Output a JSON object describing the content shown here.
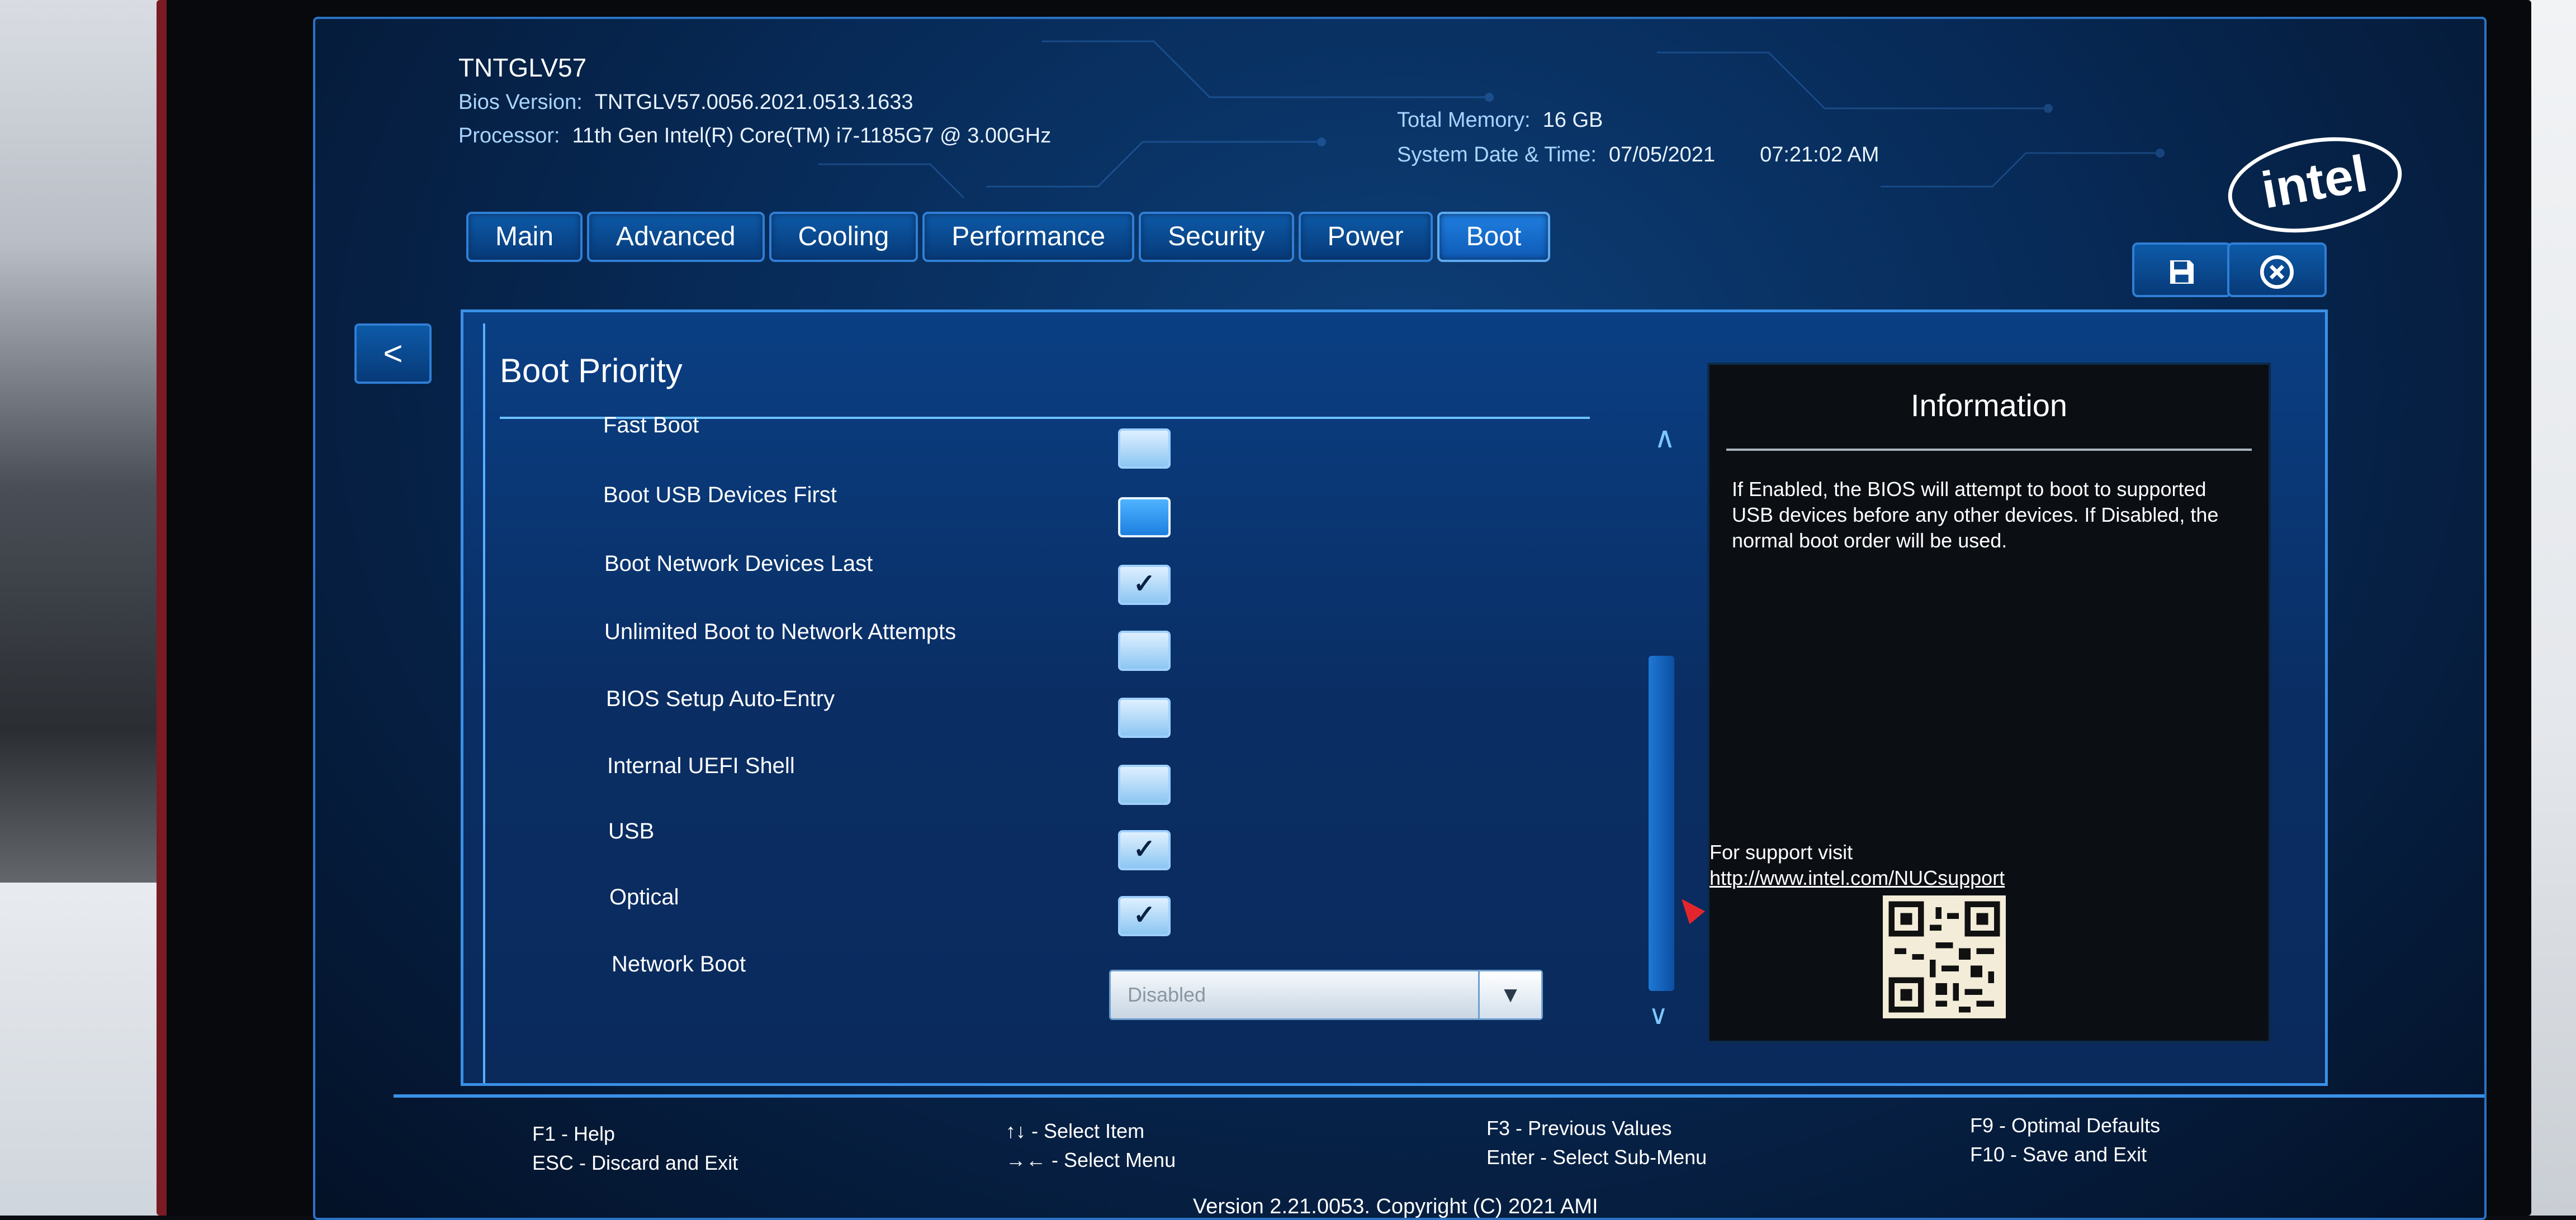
{
  "header": {
    "model": "TNTGLV57",
    "bios_version_label": "Bios Version:",
    "bios_version": "TNTGLV57.0056.2021.0513.1633",
    "processor_label": "Processor:",
    "processor": "11th Gen Intel(R) Core(TM) i7-1185G7 @ 3.00GHz",
    "total_memory_label": "Total Memory:",
    "total_memory": "16 GB",
    "date_time_label": "System Date & Time:",
    "date": "07/05/2021",
    "time": "07:21:02 AM",
    "logo_text": "intel"
  },
  "tabs": [
    {
      "label": "Main"
    },
    {
      "label": "Advanced"
    },
    {
      "label": "Cooling"
    },
    {
      "label": "Performance"
    },
    {
      "label": "Security"
    },
    {
      "label": "Power"
    },
    {
      "label": "Boot",
      "active": true
    }
  ],
  "toolbar": {
    "save_icon": "save-icon",
    "exit_icon": "close-icon",
    "back_label": "<"
  },
  "section": {
    "title": "Boot Priority",
    "options": [
      {
        "label": "Fast Boot",
        "checked": false,
        "focused": false
      },
      {
        "label": "Boot USB Devices First",
        "checked": false,
        "focused": true
      },
      {
        "label": "Boot Network Devices Last",
        "checked": true,
        "focused": false
      },
      {
        "label": "Unlimited Boot to Network Attempts",
        "checked": false,
        "focused": false
      },
      {
        "label": "BIOS Setup Auto-Entry",
        "checked": false,
        "focused": false
      },
      {
        "label": "Internal UEFI Shell",
        "checked": false,
        "focused": false
      },
      {
        "label": "USB",
        "checked": true,
        "focused": false
      },
      {
        "label": "Optical",
        "checked": true,
        "focused": false
      }
    ],
    "network_boot": {
      "label": "Network Boot",
      "value": "Disabled"
    }
  },
  "info": {
    "title": "Information",
    "text": "If Enabled, the BIOS will attempt to boot to supported USB devices before any other devices. If Disabled, the normal boot order will be used.",
    "support_label": "For support visit",
    "support_url": "http://www.intel.com/NUCsupport"
  },
  "footer": {
    "f1": "F1 - Help",
    "esc": "ESC - Discard and Exit",
    "select_item": "↑↓ - Select Item",
    "select_menu": "→← - Select Menu",
    "f3": "F3 - Previous Values",
    "enter": "Enter - Select Sub-Menu",
    "f9": "F9 - Optimal Defaults",
    "f10": "F10 - Save and Exit",
    "copyright": "Version 2.21.0053. Copyright (C) 2021 AMI"
  },
  "colors": {
    "accent": "#3a90e6",
    "panel": "#0a3f84",
    "info_bg": "#0b0e13",
    "cursor": "#e3262e"
  }
}
